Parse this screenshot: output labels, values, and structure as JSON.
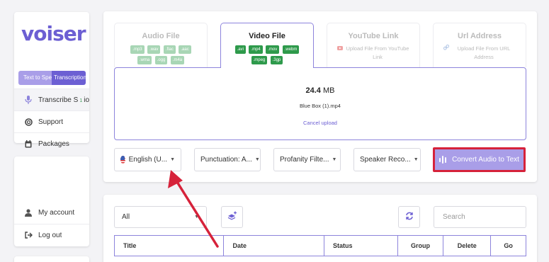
{
  "sidebar": {
    "logo": "voiser",
    "toggle": [
      "Text to Speech",
      "Transcription"
    ],
    "items": [
      {
        "label": "Transcribe S",
        "badge": "1",
        "suffix": "io",
        "icon": "microphone-icon"
      },
      {
        "label": "Support",
        "icon": "lifebuoy-icon"
      },
      {
        "label": "Packages",
        "icon": "calendar-icon"
      }
    ],
    "account_items": [
      {
        "label": "My account",
        "icon": "user-icon"
      },
      {
        "label": "Log out",
        "icon": "logout-icon"
      }
    ]
  },
  "upload": {
    "tabs": [
      {
        "name": "Audio File",
        "formats": [
          ".mp3",
          ".wav",
          ".flac",
          ".aac",
          ".wma",
          ".ogg",
          ".m4a"
        ]
      },
      {
        "name": "Video File",
        "formats": [
          ".avi",
          ".mp4",
          ".mov",
          ".webm",
          ".mpeg",
          ".3gp"
        ],
        "active": true
      },
      {
        "name": "YouTube Link",
        "sub": "Upload File From YouTube Link",
        "icon": "youtube-icon"
      },
      {
        "name": "Url Address",
        "sub": "Upload File From URL Address",
        "icon": "link-icon"
      }
    ],
    "file_size_value": "24.4",
    "file_size_unit": "MB",
    "file_name": "Blue Box (1).mp4",
    "cancel_label": "Cancel upload"
  },
  "options": {
    "language": "English (U...",
    "punctuation": "Punctuation: A...",
    "profanity": "Profanity Filte...",
    "speaker": "Speaker Reco...",
    "convert_label": "Convert Audio to Text"
  },
  "table": {
    "filter_value": "All",
    "search_placeholder": "Search",
    "columns": [
      "Title",
      "Date",
      "Status",
      "Group",
      "Delete",
      "Go"
    ]
  },
  "colors": {
    "accent": "#6c5fd3",
    "accent_light": "#a99ee8",
    "format_green": "#2e9a4b",
    "highlight_red": "#d6223a"
  }
}
